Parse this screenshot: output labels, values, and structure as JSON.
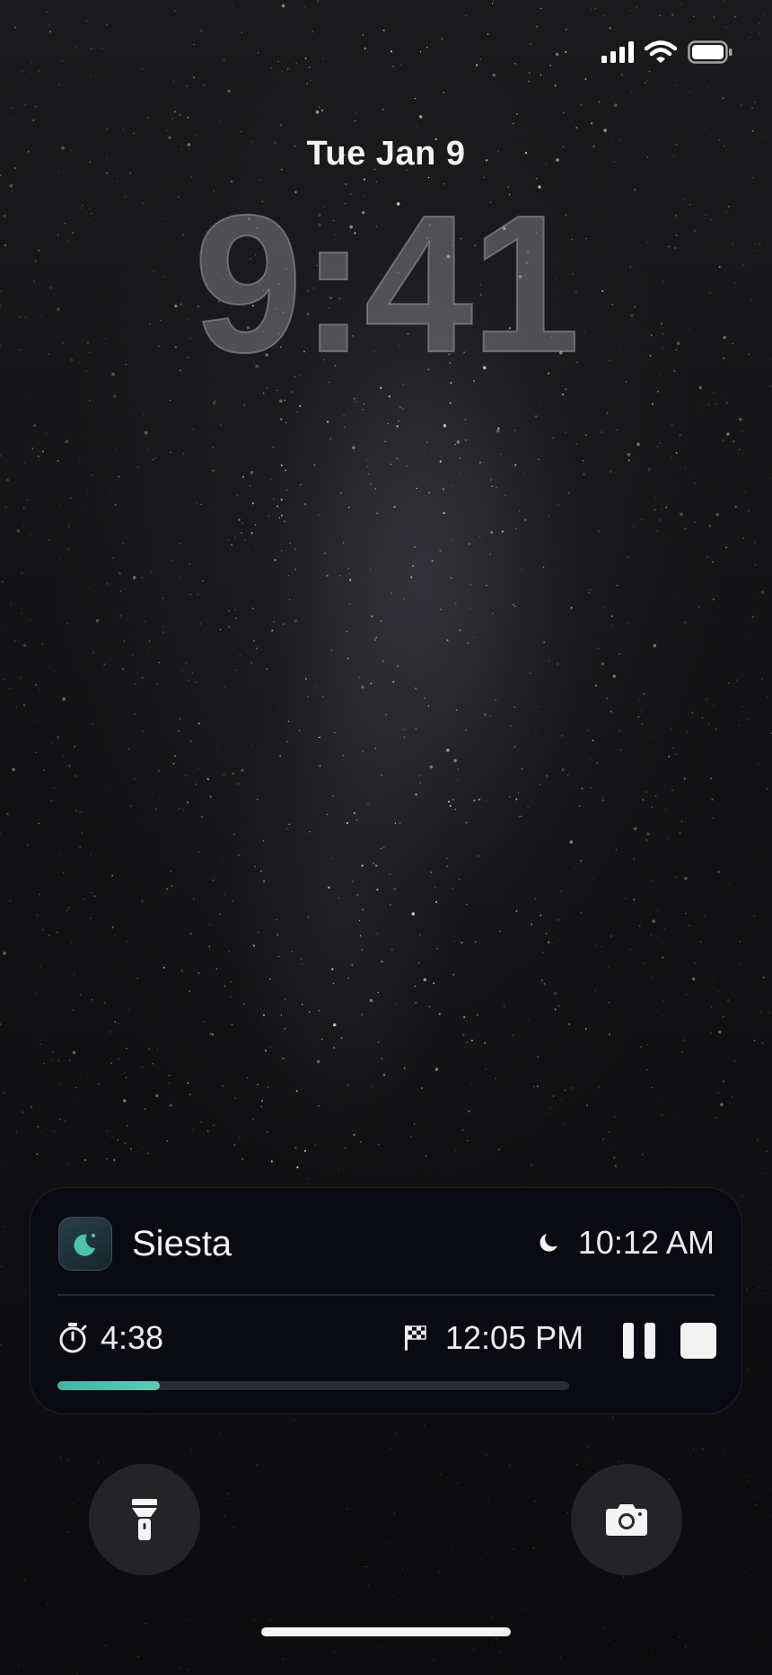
{
  "status_bar": {
    "signal_icon": "cellular-signal-icon",
    "wifi_icon": "wifi-icon",
    "battery_icon": "battery-icon"
  },
  "lock_screen": {
    "date": "Tue Jan 9",
    "time": "9:41"
  },
  "live_activity": {
    "app_name": "Siesta",
    "app_icon": "moon-app-icon",
    "start_icon": "moon-icon",
    "start_time": "10:12 AM",
    "elapsed_icon": "stopwatch-icon",
    "elapsed": "4:38",
    "end_icon": "checkered-flag-icon",
    "end_time": "12:05 PM",
    "pause_icon": "pause-icon",
    "stop_icon": "stop-icon",
    "progress_fraction": 0.2,
    "accent_color": "#4cc2ad"
  },
  "controls": {
    "flashlight_icon": "flashlight-icon",
    "camera_icon": "camera-icon"
  }
}
